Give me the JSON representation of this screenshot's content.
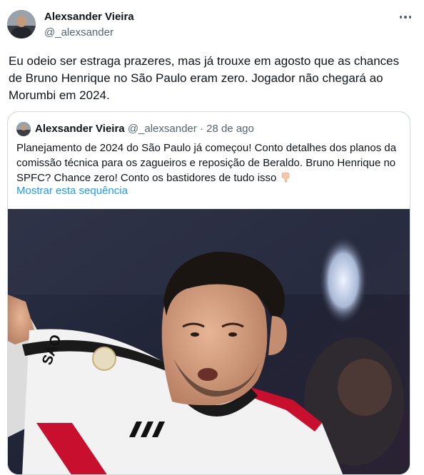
{
  "author": {
    "name": "Alexsander Vieira",
    "handle": "@_alexsander"
  },
  "tweet": {
    "text": "Eu odeio ser estraga prazeres, mas já trouxe em agosto que as chances de Bruno Henrique no São Paulo eram zero. Jogador não chegará ao Morumbi em 2024."
  },
  "quote": {
    "name": "Alexsander Vieira",
    "handle": "@_alexsander",
    "separator": "·",
    "date": "28 de ago",
    "text": "Planejamento de 2024 do São Paulo já começou! Conto detalhes dos planos da comissão técnica para os zagueiros e reposição de Beraldo. Bruno Henrique no SPFC? Chance zero! Conto os bastidores de tudo isso",
    "show_thread": "Mostrar esta sequência"
  },
  "icons": {
    "more": "more-options-icon",
    "emoji": "pointing-down-emoji"
  },
  "colors": {
    "link": "#1d9bf0",
    "secondary_text": "#536471",
    "border": "#cfd9de"
  }
}
